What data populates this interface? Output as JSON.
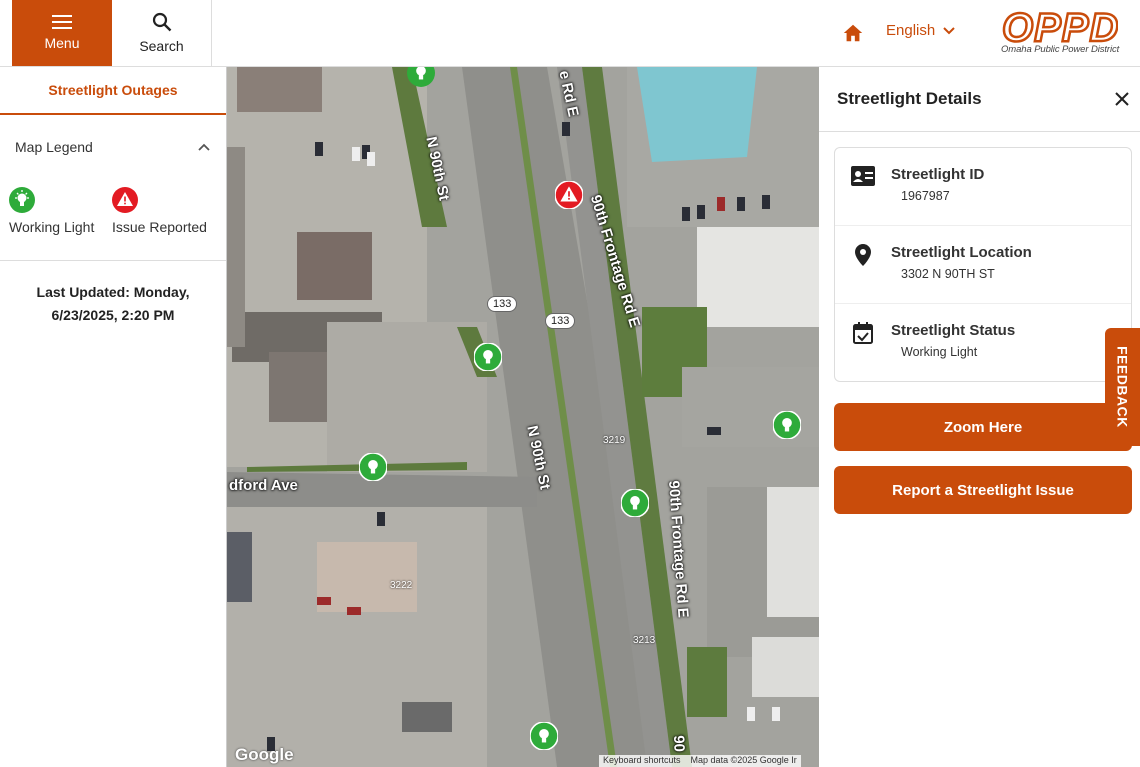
{
  "header": {
    "menu_label": "Menu",
    "search_label": "Search",
    "language": "English",
    "logo_name": "Omaha Public Power District",
    "logo_mark": "OPPD"
  },
  "left_panel": {
    "tab_label": "Streetlight Outages",
    "legend_title": "Map Legend",
    "legend_items": [
      {
        "label": "Working Light",
        "icon": "lightbulb-icon",
        "color": "#2eab3a"
      },
      {
        "label": "Issue Reported",
        "icon": "warning-icon",
        "color": "#e31b23"
      }
    ],
    "last_updated_line1": "Last Updated: Monday,",
    "last_updated_line2": "6/23/2025, 2:20 PM"
  },
  "map": {
    "labels": {
      "n90th_top": "N 90th St",
      "n90th_mid": "N 90th St",
      "frontage_top": "90th Frontage Rd E",
      "frontage_mid": "90th Frontage Rd E",
      "frontage_cut_top": "e Rd E",
      "frontage_cut_bottom": "90",
      "bedford": "dford Ave"
    },
    "route_shields": [
      "133",
      "133"
    ],
    "addresses": [
      "3219",
      "3222",
      "3213"
    ],
    "google_logo": "Google",
    "attribution": [
      "Keyboard shortcuts",
      "Map data ©2025 Google Ir"
    ]
  },
  "details": {
    "title": "Streetlight Details",
    "id_label": "Streetlight ID",
    "id_value": "1967987",
    "location_label": "Streetlight Location",
    "location_value": "3302 N 90TH ST",
    "status_label": "Streetlight Status",
    "status_value": "Working Light",
    "zoom_button": "Zoom Here",
    "report_button": "Report a Streetlight Issue"
  },
  "feedback_label": "FEEDBACK",
  "colors": {
    "brand": "#c94c0b",
    "working": "#2eab3a",
    "issue": "#e31b23"
  }
}
